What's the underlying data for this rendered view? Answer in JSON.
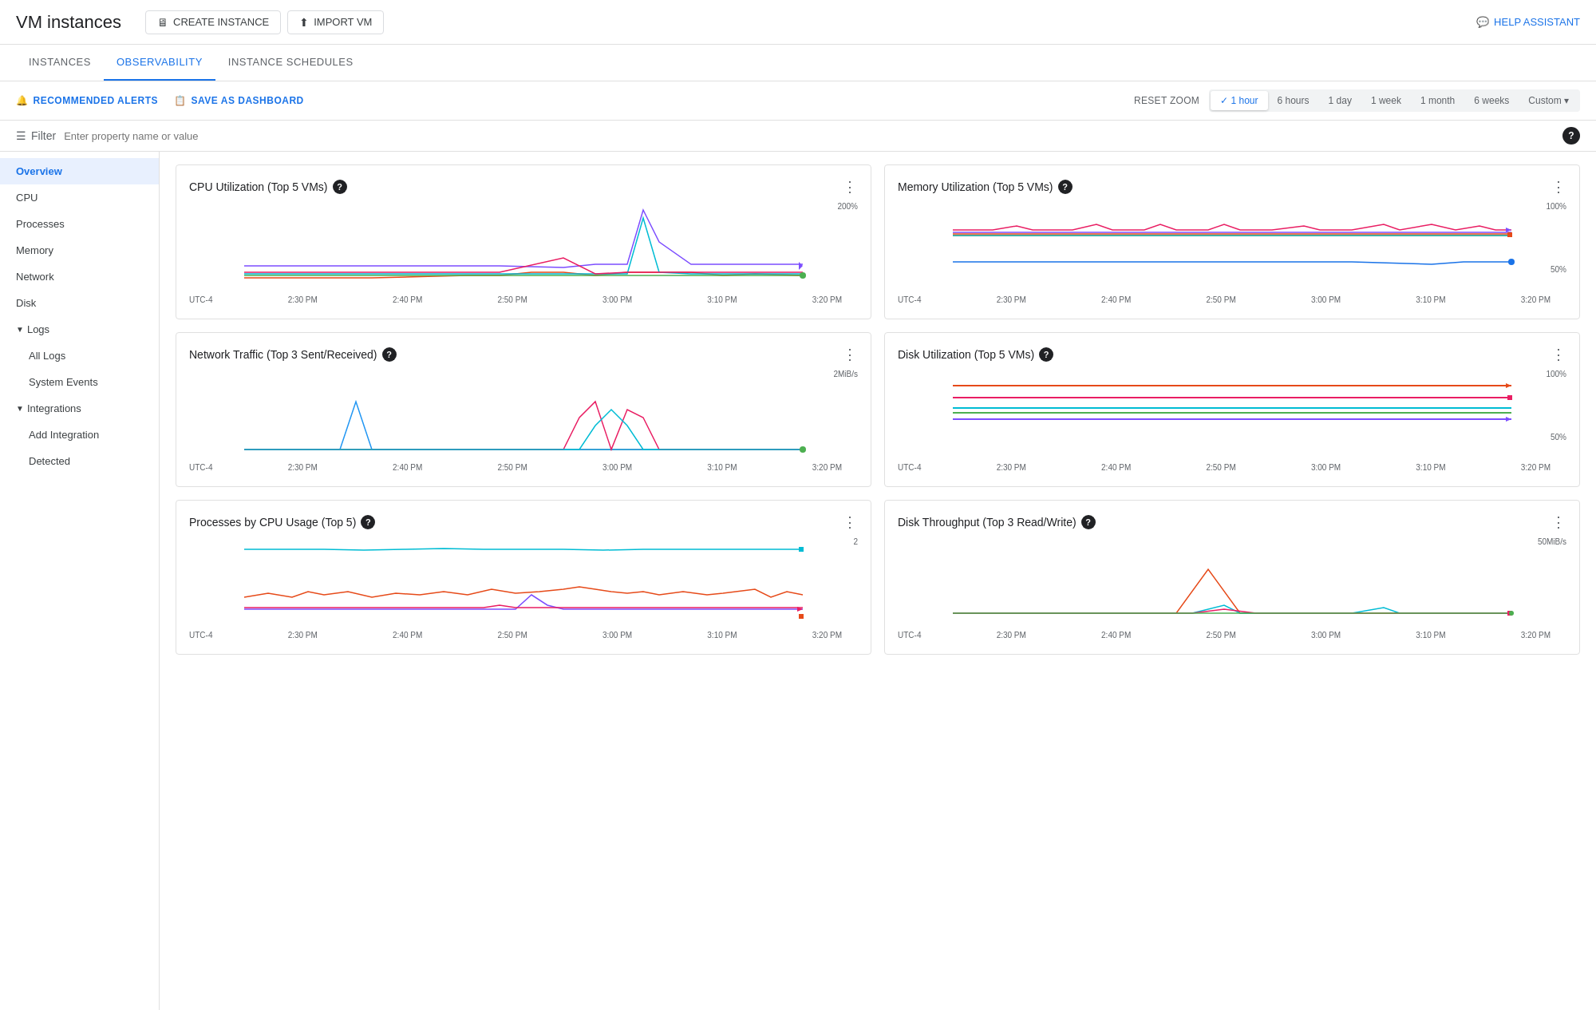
{
  "header": {
    "title": "VM instances",
    "create_instance_label": "CREATE INSTANCE",
    "import_vm_label": "IMPORT VM",
    "help_assistant_label": "HELP ASSISTANT"
  },
  "tabs": [
    {
      "id": "instances",
      "label": "INSTANCES",
      "active": false
    },
    {
      "id": "observability",
      "label": "OBSERVABILITY",
      "active": true
    },
    {
      "id": "schedules",
      "label": "INSTANCE SCHEDULES",
      "active": false
    }
  ],
  "toolbar": {
    "recommended_alerts_label": "RECOMMENDED ALERTS",
    "save_as_dashboard_label": "SAVE AS DASHBOARD",
    "reset_zoom_label": "RESET ZOOM",
    "time_filters": [
      {
        "label": "1 hour",
        "active": true,
        "check": true
      },
      {
        "label": "6 hours",
        "active": false
      },
      {
        "label": "1 day",
        "active": false
      },
      {
        "label": "1 week",
        "active": false
      },
      {
        "label": "1 month",
        "active": false
      },
      {
        "label": "6 weeks",
        "active": false
      },
      {
        "label": "Custom",
        "active": false,
        "dropdown": true
      }
    ]
  },
  "filter": {
    "label": "Filter",
    "placeholder": "Enter property name or value"
  },
  "sidebar": {
    "items": [
      {
        "id": "overview",
        "label": "Overview",
        "active": true,
        "indent": false
      },
      {
        "id": "cpu",
        "label": "CPU",
        "active": false,
        "indent": false
      },
      {
        "id": "processes",
        "label": "Processes",
        "active": false,
        "indent": false
      },
      {
        "id": "memory",
        "label": "Memory",
        "active": false,
        "indent": false
      },
      {
        "id": "network",
        "label": "Network",
        "active": false,
        "indent": false
      },
      {
        "id": "disk",
        "label": "Disk",
        "active": false,
        "indent": false
      },
      {
        "id": "logs-group",
        "label": "Logs",
        "active": false,
        "group": true,
        "expanded": true
      },
      {
        "id": "all-logs",
        "label": "All Logs",
        "active": false,
        "indent": true
      },
      {
        "id": "system-events",
        "label": "System Events",
        "active": false,
        "indent": true
      },
      {
        "id": "integrations-group",
        "label": "Integrations",
        "active": false,
        "group": true,
        "expanded": true
      },
      {
        "id": "add-integration",
        "label": "Add Integration",
        "active": false,
        "indent": true
      },
      {
        "id": "detected",
        "label": "Detected",
        "active": false,
        "indent": true
      }
    ]
  },
  "charts": [
    {
      "id": "cpu-utilization",
      "title": "CPU Utilization (Top 5 VMs)",
      "y_max": "200%",
      "y_mid": "",
      "x_labels": [
        "UTC-4",
        "2:30 PM",
        "2:40 PM",
        "2:50 PM",
        "3:00 PM",
        "3:10 PM",
        "3:20 PM"
      ],
      "position": 0
    },
    {
      "id": "memory-utilization",
      "title": "Memory Utilization (Top 5 VMs)",
      "y_max": "100%",
      "y_mid": "50%",
      "x_labels": [
        "UTC-4",
        "2:30 PM",
        "2:40 PM",
        "2:50 PM",
        "3:00 PM",
        "3:10 PM",
        "3:20 PM"
      ],
      "position": 1
    },
    {
      "id": "network-traffic",
      "title": "Network Traffic (Top 3 Sent/Received)",
      "y_max": "2MiB/s",
      "y_mid": "",
      "x_labels": [
        "UTC-4",
        "2:30 PM",
        "2:40 PM",
        "2:50 PM",
        "3:00 PM",
        "3:10 PM",
        "3:20 PM"
      ],
      "position": 2
    },
    {
      "id": "disk-utilization",
      "title": "Disk Utilization (Top 5 VMs)",
      "y_max": "100%",
      "y_mid": "50%",
      "x_labels": [
        "UTC-4",
        "2:30 PM",
        "2:40 PM",
        "2:50 PM",
        "3:00 PM",
        "3:10 PM",
        "3:20 PM"
      ],
      "position": 3
    },
    {
      "id": "processes-cpu",
      "title": "Processes by CPU Usage (Top 5)",
      "y_max": "2",
      "y_mid": "",
      "x_labels": [
        "UTC-4",
        "2:30 PM",
        "2:40 PM",
        "2:50 PM",
        "3:00 PM",
        "3:10 PM",
        "3:20 PM"
      ],
      "position": 4
    },
    {
      "id": "disk-throughput",
      "title": "Disk Throughput (Top 3 Read/Write)",
      "y_max": "50MiB/s",
      "y_mid": "",
      "x_labels": [
        "UTC-4",
        "2:30 PM",
        "2:40 PM",
        "2:50 PM",
        "3:00 PM",
        "3:10 PM",
        "3:20 PM"
      ],
      "position": 5
    }
  ]
}
